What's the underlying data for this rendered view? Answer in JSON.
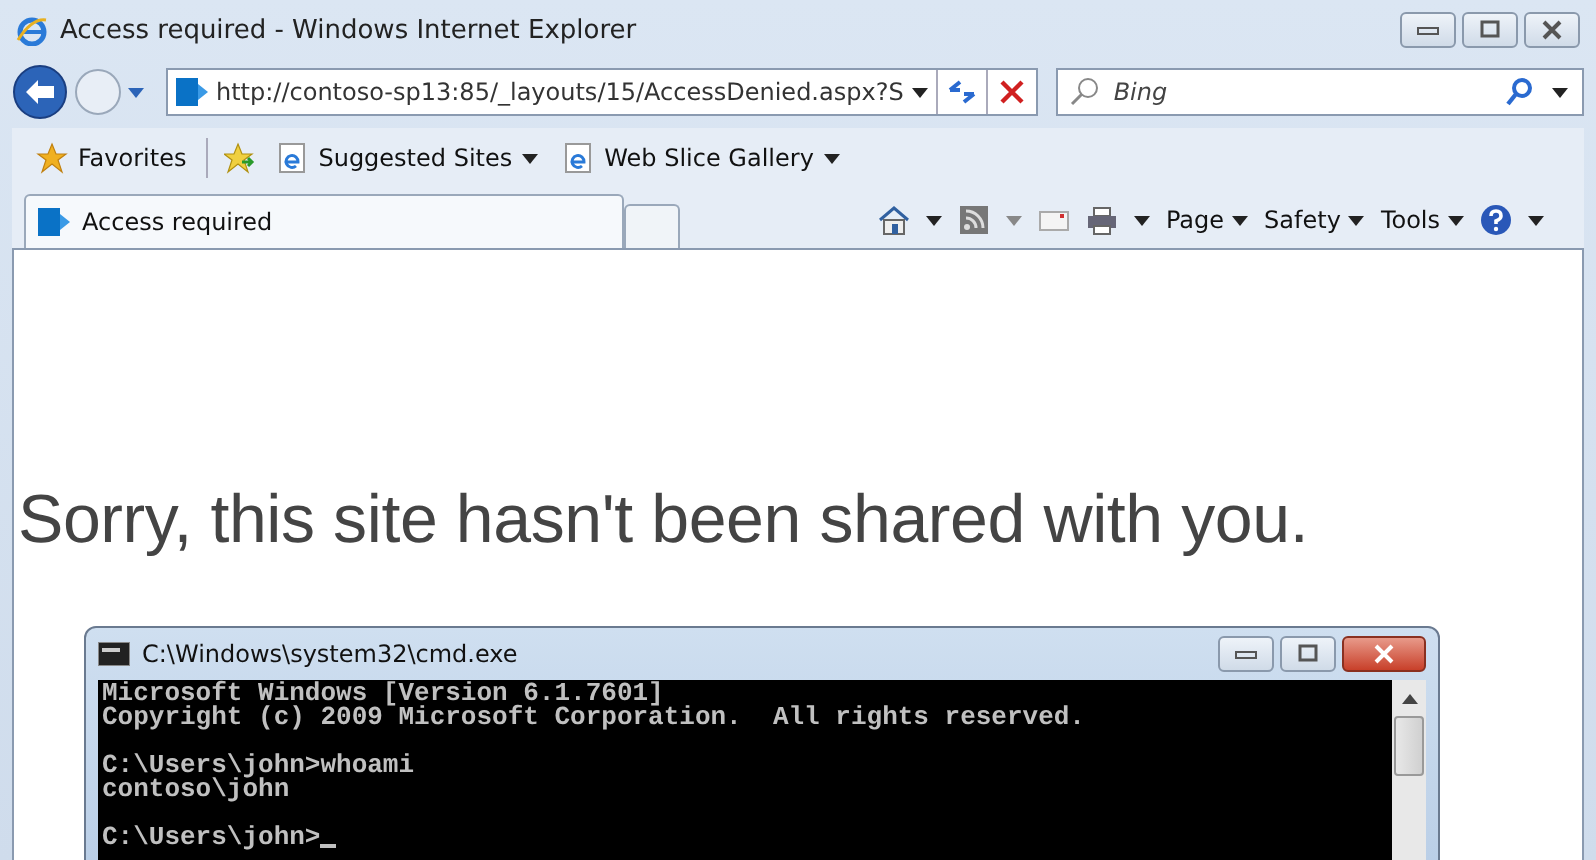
{
  "window": {
    "title": "Access required - Windows Internet Explorer"
  },
  "address_bar": {
    "url": "http://contoso-sp13:85/_layouts/15/AccessDenied.aspx?S"
  },
  "search": {
    "placeholder": "Bing"
  },
  "favorites_bar": {
    "favorites": "Favorites",
    "links": [
      "Suggested Sites",
      "Web Slice Gallery"
    ]
  },
  "tabs": [
    {
      "label": "Access required",
      "selected": true
    }
  ],
  "command_bar": [
    "Page",
    "Safety",
    "Tools"
  ],
  "page": {
    "heading": "Sorry, this site hasn't been shared with you."
  },
  "console": {
    "title": "C:\\Windows\\system32\\cmd.exe",
    "blocks": [
      [
        "Microsoft Windows [Version 6.1.7601]",
        "Copyright (c) 2009 Microsoft Corporation.  All rights reserved."
      ],
      [
        "C:\\Users\\john>whoami",
        "contoso\\john"
      ],
      [
        "C:\\Users\\john>"
      ]
    ]
  }
}
